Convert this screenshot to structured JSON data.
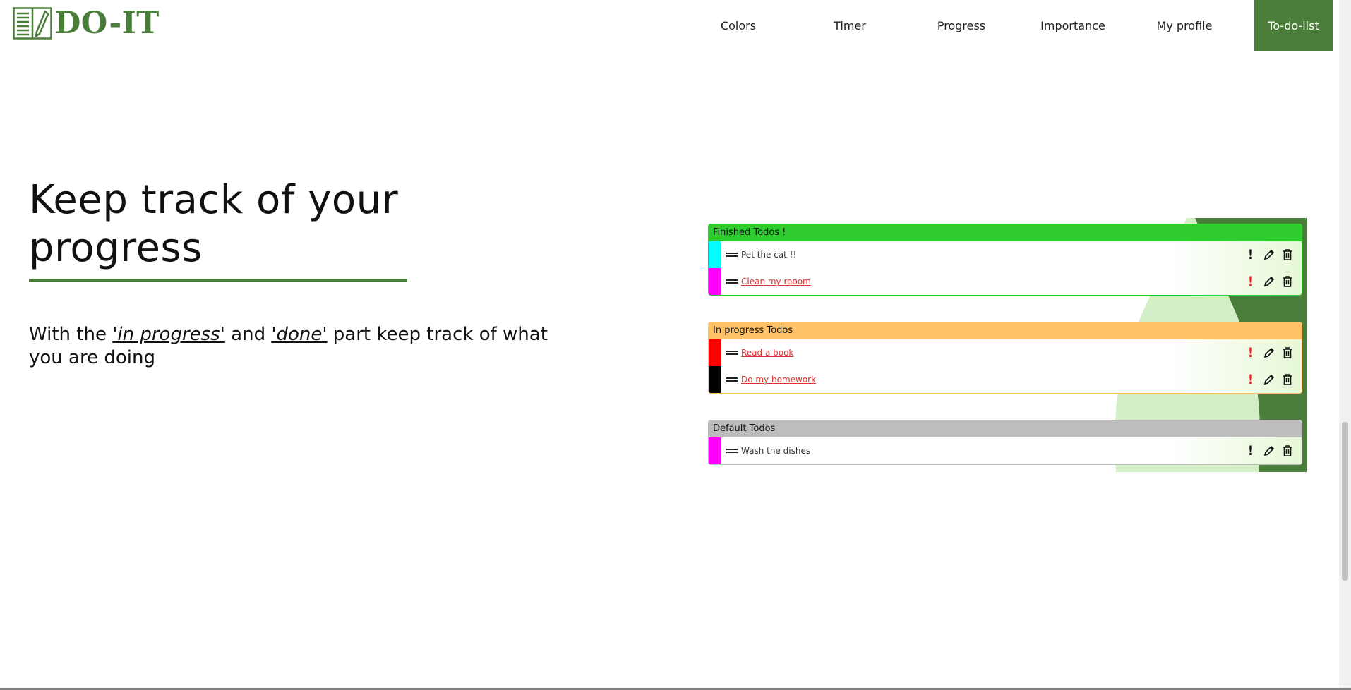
{
  "brand": {
    "name": "DO-IT",
    "color": "#4b7d3a",
    "icon": "notebook-pencil-icon"
  },
  "nav": {
    "items": [
      {
        "label": "Colors"
      },
      {
        "label": "Timer"
      },
      {
        "label": "Progress"
      },
      {
        "label": "Importance"
      },
      {
        "label": "My profile"
      },
      {
        "label": "To-do-list",
        "active": true
      }
    ]
  },
  "hero": {
    "title": "Keep track of your progress",
    "desc_before": "With the ",
    "desc_em1": "'in progress'",
    "desc_mid": " and ",
    "desc_em2": "'done'",
    "desc_after": " part keep track of what you are doing"
  },
  "illustration": {
    "groups": [
      {
        "title": "Finished Todos !",
        "color": "#2ecc2e",
        "todos": [
          {
            "text": "Pet the cat !!",
            "swatch": "#00ffff",
            "link": false,
            "important": false
          },
          {
            "text": "Clean my rooom",
            "swatch": "#ff00ff",
            "link": true,
            "important": true
          }
        ]
      },
      {
        "title": "In progress Todos",
        "color": "#ffc266",
        "todos": [
          {
            "text": "Read a book",
            "swatch": "#ff0000",
            "link": true,
            "important": true
          },
          {
            "text": "Do my homework",
            "swatch": "#000000",
            "link": true,
            "important": true
          }
        ]
      },
      {
        "title": "Default Todos",
        "color": "#bdbdbd",
        "todos": [
          {
            "text": "Wash the dishes",
            "swatch": "#ff00ff",
            "link": false,
            "important": false
          }
        ]
      }
    ],
    "icons": [
      "exclamation-icon",
      "pencil-icon",
      "trash-icon",
      "drag-handle-icon"
    ]
  }
}
